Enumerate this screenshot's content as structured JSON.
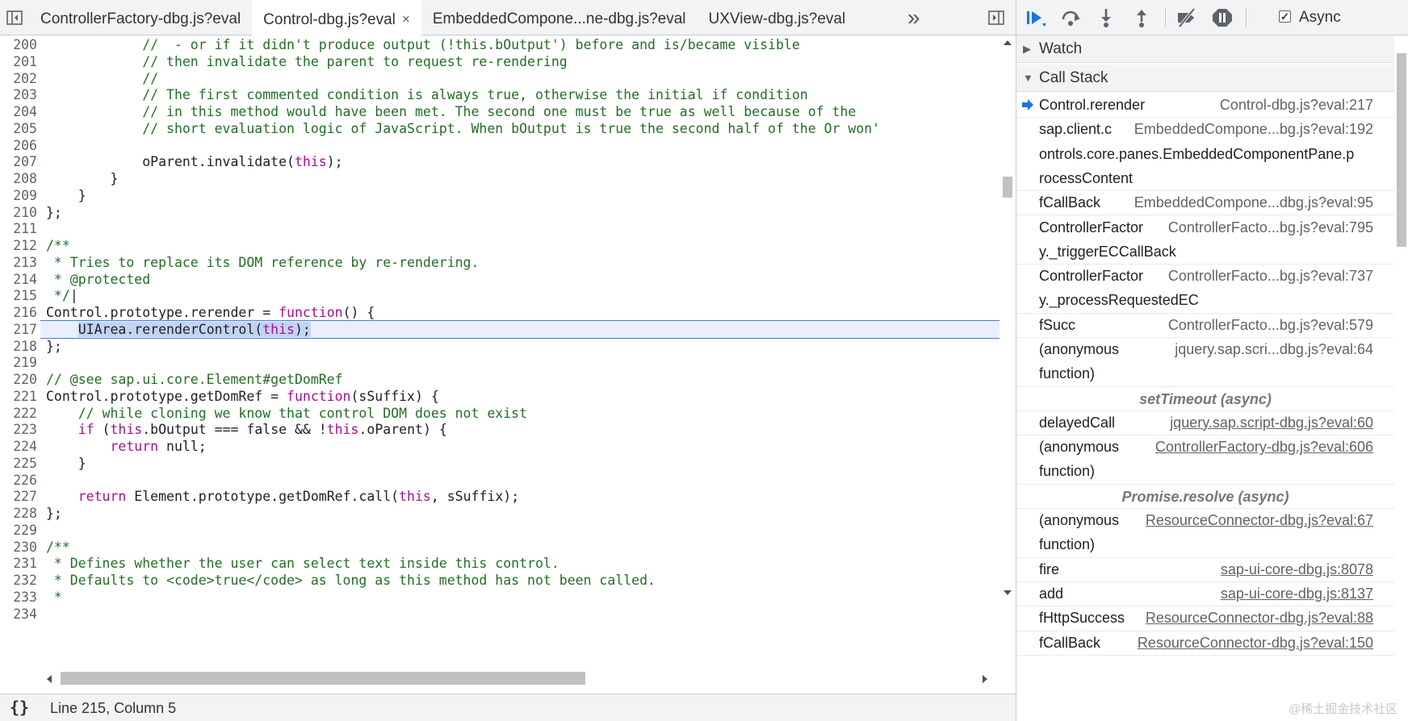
{
  "tabs": [
    {
      "label": "ControllerFactory-dbg.js?eval",
      "active": false
    },
    {
      "label": "Control-dbg.js?eval",
      "active": true,
      "close": "×"
    },
    {
      "label": "EmbeddedCompone...ne-dbg.js?eval",
      "active": false
    },
    {
      "label": "UXView-dbg.js?eval",
      "active": false
    }
  ],
  "tab_more": "»",
  "code_lines": [
    {
      "n": "200",
      "html": "<span class=\"c\">            //  - or if it didn't produce output (!this.bOutput') before and is/became visible</span>"
    },
    {
      "n": "201",
      "html": "<span class=\"c\">            // then invalidate the parent to request re-rendering</span>"
    },
    {
      "n": "202",
      "html": "<span class=\"c\">            //</span>"
    },
    {
      "n": "203",
      "html": "<span class=\"c\">            // The first commented condition is always true, otherwise the initial if condition</span>"
    },
    {
      "n": "204",
      "html": "<span class=\"c\">            // in this method would have been met. The second one must be true as well because of the</span>"
    },
    {
      "n": "205",
      "html": "<span class=\"c\">            // short evaluation logic of JavaScript. When bOutput is true the second half of the Or won'</span>"
    },
    {
      "n": "206",
      "html": ""
    },
    {
      "n": "207",
      "html": "            oParent.invalidate(<span class=\"k\">this</span>);"
    },
    {
      "n": "208",
      "html": "        }"
    },
    {
      "n": "209",
      "html": "    }"
    },
    {
      "n": "210",
      "html": "};"
    },
    {
      "n": "211",
      "html": ""
    },
    {
      "n": "212",
      "html": "<span class=\"c\">/**</span>"
    },
    {
      "n": "213",
      "html": "<span class=\"c\"> * Tries to replace its DOM reference by re-rendering.</span>"
    },
    {
      "n": "214",
      "html": "<span class=\"c\"> * @protected</span>"
    },
    {
      "n": "215",
      "html": "<span class=\"c\"> */</span>|"
    },
    {
      "n": "216",
      "html": "Control.prototype.rerender = <span class=\"k\">function</span>() {"
    },
    {
      "n": "217",
      "html": "    <span class=\"tok-sel\">UIArea.rerenderControl(<span class=\"k\">this</span>);</span>",
      "highlight": true
    },
    {
      "n": "218",
      "html": "};"
    },
    {
      "n": "219",
      "html": ""
    },
    {
      "n": "220",
      "html": "<span class=\"c\">// @see sap.ui.core.Element#getDomRef</span>"
    },
    {
      "n": "221",
      "html": "Control.prototype.getDomRef = <span class=\"k\">function</span>(sSuffix) {"
    },
    {
      "n": "222",
      "html": "<span class=\"c\">    // while cloning we know that control DOM does not exist</span>"
    },
    {
      "n": "223",
      "html": "    <span class=\"k\">if</span> (<span class=\"k\">this</span>.bOutput === false &amp;&amp; !<span class=\"k\">this</span>.oParent) {"
    },
    {
      "n": "224",
      "html": "        <span class=\"k\">return</span> null;"
    },
    {
      "n": "225",
      "html": "    }"
    },
    {
      "n": "226",
      "html": ""
    },
    {
      "n": "227",
      "html": "    <span class=\"k\">return</span> Element.prototype.getDomRef.call(<span class=\"k\">this</span>, sSuffix);"
    },
    {
      "n": "228",
      "html": "};"
    },
    {
      "n": "229",
      "html": ""
    },
    {
      "n": "230",
      "html": "<span class=\"c\">/**</span>"
    },
    {
      "n": "231",
      "html": "<span class=\"c\"> * Defines whether the user can select text inside this control.</span>"
    },
    {
      "n": "232",
      "html": "<span class=\"c\"> * Defaults to &lt;code&gt;true&lt;/code&gt; as long as this method has not been called.</span>"
    },
    {
      "n": "233",
      "html": "<span class=\"c\"> *</span>"
    },
    {
      "n": "234",
      "html": ""
    }
  ],
  "status": {
    "braces": "{}",
    "position": "Line 215, Column 5"
  },
  "debugger": {
    "async_label": "Async",
    "async_checked": "✓",
    "watch_label": "Watch",
    "callstack_label": "Call Stack"
  },
  "callstack": [
    {
      "type": "frame",
      "fn": "Control.rerender",
      "loc": "Control-dbg.js?eval:217",
      "current": true
    },
    {
      "type": "frame",
      "fn": "sap.client.c",
      "fn2": "ontrols.core.panes.EmbeddedComponentPane.p",
      "fn3": "rocessContent",
      "loc": "EmbeddedCompone...bg.js?eval:192"
    },
    {
      "type": "frame",
      "fn": "fCallBack",
      "loc": "EmbeddedCompone...dbg.js?eval:95"
    },
    {
      "type": "frame",
      "fn": "ControllerFactor",
      "fn2": "y._triggerECCallBack",
      "loc": "ControllerFacto...bg.js?eval:795"
    },
    {
      "type": "frame",
      "fn": "ControllerFactor",
      "fn2": "y._processRequestedEC",
      "loc": "ControllerFacto...bg.js?eval:737"
    },
    {
      "type": "frame",
      "fn": "fSucc",
      "loc": "ControllerFacto...bg.js?eval:579"
    },
    {
      "type": "frame",
      "fn": "(anonymous",
      "fn2": "function)",
      "loc": "jquery.sap.scri...dbg.js?eval:64"
    },
    {
      "type": "async",
      "label": "setTimeout (async)"
    },
    {
      "type": "frame",
      "fn": "delayedCall",
      "loc": "jquery.sap.script-dbg.js?eval:60",
      "underline": true
    },
    {
      "type": "frame",
      "fn": "(anonymous",
      "fn2": "function)",
      "loc": "ControllerFactory-dbg.js?eval:606",
      "underline": true
    },
    {
      "type": "async",
      "label": "Promise.resolve (async)"
    },
    {
      "type": "frame",
      "fn": "(anonymous",
      "fn2": "function)",
      "loc": "ResourceConnector-dbg.js?eval:67",
      "underline": true
    },
    {
      "type": "frame",
      "fn": "fire",
      "loc": "sap-ui-core-dbg.js:8078",
      "underline": true
    },
    {
      "type": "frame",
      "fn": "add",
      "loc": "sap-ui-core-dbg.js:8137",
      "underline": true
    },
    {
      "type": "frame",
      "fn": "fHttpSuccess",
      "loc": "ResourceConnector-dbg.js?eval:88",
      "underline": true
    },
    {
      "type": "frame",
      "fn": "fCallBack",
      "loc": "ResourceConnector-dbg.js?eval:150",
      "underline": true
    }
  ],
  "watermark": "@稀土掘金技术社区",
  "colors": {
    "accent": "#1a73e8",
    "comment": "#236e25",
    "keyword": "#aa0d91",
    "highlight": "#e8f0fe"
  }
}
